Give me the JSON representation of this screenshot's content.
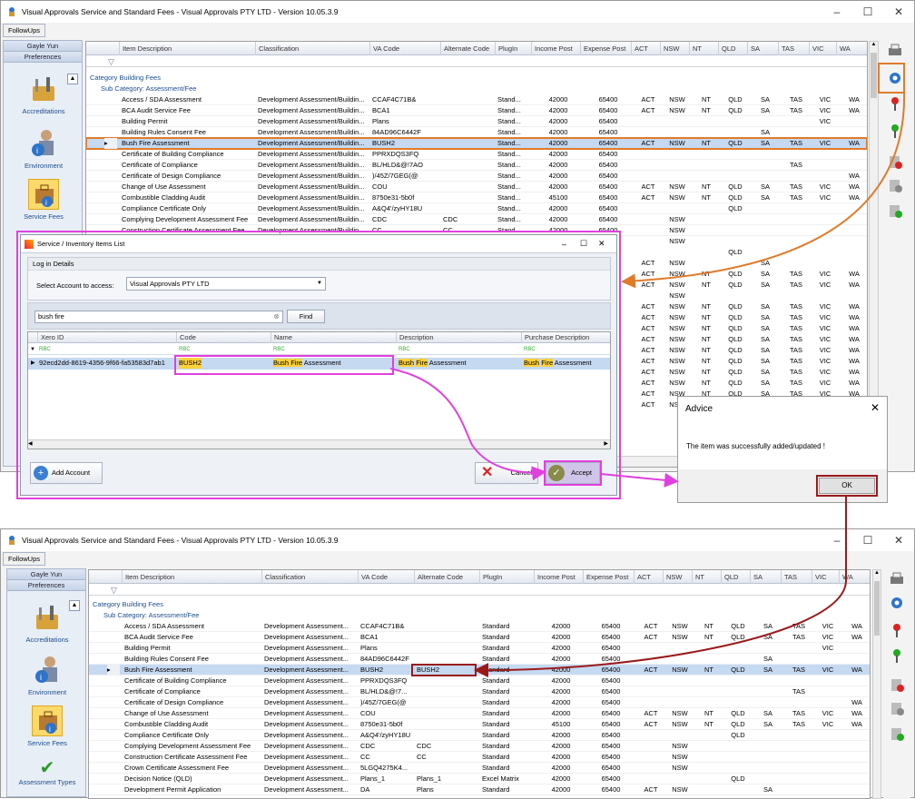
{
  "app": {
    "title": "Visual Approvals Service and Standard Fees - Visual Approvals PTY LTD - Version 10.05.3.9",
    "follow_ups": "FollowUps"
  },
  "nav": {
    "user": "Gayle Yun",
    "preferences": "Preferences",
    "items": [
      "Accreditations",
      "Environment",
      "Service Fees",
      "Assessment Types"
    ]
  },
  "grid": {
    "columns": [
      "Item Description",
      "Classification",
      "VA Code",
      "Alternate Code",
      "PlugIn",
      "Income Post",
      "Expense Post",
      "ACT",
      "NSW",
      "NT",
      "QLD",
      "SA",
      "TAS",
      "VIC",
      "WA"
    ],
    "category": "Category  Building Fees",
    "subcategory": "Sub Category:  Assessment/Fee",
    "rows_top": [
      [
        "Access / SDA Assessment",
        "Development Assessment/Buildin...",
        "CCAF4C71B&",
        "",
        "Stand...",
        "42000",
        "65400",
        "ACT",
        "NSW",
        "NT",
        "QLD",
        "SA",
        "TAS",
        "VIC",
        "WA"
      ],
      [
        "BCA Audit Service Fee",
        "Development Assessment/Buildin...",
        "BCA1",
        "",
        "Stand...",
        "42000",
        "65400",
        "ACT",
        "NSW",
        "NT",
        "QLD",
        "SA",
        "TAS",
        "VIC",
        "WA"
      ],
      [
        "Building Permit",
        "Development Assessment/Buildin...",
        "Plans",
        "",
        "Stand...",
        "42000",
        "65400",
        "",
        "",
        "",
        "",
        "",
        "",
        "VIC",
        ""
      ],
      [
        "Building Rules Consent Fee",
        "Development Assessment/Buildin...",
        "84AD96C6442F",
        "",
        "Stand...",
        "42000",
        "65400",
        "",
        "",
        "",
        "",
        "SA",
        "",
        "",
        ""
      ],
      [
        "Bush Fire Assessment",
        "Development Assessment/Buildin...",
        "BUSH2",
        "",
        "Stand...",
        "42000",
        "65400",
        "ACT",
        "NSW",
        "NT",
        "QLD",
        "SA",
        "TAS",
        "VIC",
        "WA"
      ],
      [
        "Certificate of Building Compliance",
        "Development Assessment/Buildin...",
        "PPRXDQS3FQ",
        "",
        "Stand...",
        "42000",
        "65400",
        "",
        "",
        "",
        "",
        "",
        "",
        "",
        ""
      ],
      [
        "Certificate of Compliance",
        "Development Assessment/Buildin...",
        "BL/HLD&@!7AO",
        "",
        "Stand...",
        "42000",
        "65400",
        "",
        "",
        "",
        "",
        "",
        "TAS",
        "",
        ""
      ],
      [
        "Certificate of Design Compliance",
        "Development Assessment/Buildin...",
        ")/45Z/7GEG(@",
        "",
        "Stand...",
        "42000",
        "65400",
        "",
        "",
        "",
        "",
        "",
        "",
        "",
        "WA"
      ],
      [
        "Change of Use Assessment",
        "Development Assessment/Buildin...",
        "COU",
        "",
        "Stand...",
        "42000",
        "65400",
        "ACT",
        "NSW",
        "NT",
        "QLD",
        "SA",
        "TAS",
        "VIC",
        "WA"
      ],
      [
        "Combustible Cladding Audit",
        "Development Assessment/Buildin...",
        "8750e31-5b0f",
        "",
        "Stand...",
        "45100",
        "65400",
        "ACT",
        "NSW",
        "NT",
        "QLD",
        "SA",
        "TAS",
        "VIC",
        "WA"
      ],
      [
        "Compliance Certificate Only",
        "Development Assessment/Buildin...",
        "A&Q4'/zyHY18U",
        "",
        "Stand...",
        "42000",
        "65400",
        "",
        "",
        "",
        "QLD",
        "",
        "",
        "",
        ""
      ],
      [
        "Complying Development Assessment Fee",
        "Development Assessment/Buildin...",
        "CDC",
        "CDC",
        "Stand...",
        "42000",
        "65400",
        "",
        "NSW",
        "",
        "",
        "",
        "",
        "",
        ""
      ],
      [
        "Construction Certificate Assessment Fee",
        "Development Assessment/Buildin...",
        "CC",
        "CC",
        "Stand...",
        "42000",
        "65400",
        "",
        "NSW",
        "",
        "",
        "",
        "",
        "",
        ""
      ]
    ],
    "rows_bottom": [
      [
        "Access / SDA Assessment",
        "Development Assessment...",
        "CCAF4C71B&",
        "",
        "Standard",
        "42000",
        "65400",
        "ACT",
        "NSW",
        "NT",
        "QLD",
        "SA",
        "TAS",
        "VIC",
        "WA"
      ],
      [
        "BCA Audit Service Fee",
        "Development Assessment...",
        "BCA1",
        "",
        "Standard",
        "42000",
        "65400",
        "ACT",
        "NSW",
        "NT",
        "QLD",
        "SA",
        "TAS",
        "VIC",
        "WA"
      ],
      [
        "Building Permit",
        "Development Assessment...",
        "Plans",
        "",
        "Standard",
        "42000",
        "65400",
        "",
        "",
        "",
        "",
        "",
        "",
        "VIC",
        ""
      ],
      [
        "Building Rules Consent Fee",
        "Development Assessment...",
        "84AD96C6442F",
        "",
        "Standard",
        "42000",
        "65400",
        "",
        "",
        "",
        "",
        "SA",
        "",
        "",
        ""
      ],
      [
        "Bush Fire Assessment",
        "Development Assessment...",
        "BUSH2",
        "BUSH2",
        "Standard",
        "42000",
        "65400",
        "ACT",
        "NSW",
        "NT",
        "QLD",
        "SA",
        "TAS",
        "VIC",
        "WA"
      ],
      [
        "Certificate of Building Compliance",
        "Development Assessment...",
        "PPRXDQS3FQ",
        "",
        "Standard",
        "42000",
        "65400",
        "",
        "",
        "",
        "",
        "",
        "",
        "",
        ""
      ],
      [
        "Certificate of Compliance",
        "Development Assessment...",
        "BL/HLD&@!7...",
        "",
        "Standard",
        "42000",
        "65400",
        "",
        "",
        "",
        "",
        "",
        "TAS",
        "",
        ""
      ],
      [
        "Certificate of Design Compliance",
        "Development Assessment...",
        ")/45Z/7GEG(@",
        "",
        "Standard",
        "42000",
        "65400",
        "",
        "",
        "",
        "",
        "",
        "",
        "",
        "WA"
      ],
      [
        "Change of Use Assessment",
        "Development Assessment...",
        "COU",
        "",
        "Standard",
        "42000",
        "65400",
        "ACT",
        "NSW",
        "NT",
        "QLD",
        "SA",
        "TAS",
        "VIC",
        "WA"
      ],
      [
        "Combustible Cladding Audit",
        "Development Assessment...",
        "8750e31-5b0f",
        "",
        "Standard",
        "45100",
        "65400",
        "ACT",
        "NSW",
        "NT",
        "QLD",
        "SA",
        "TAS",
        "VIC",
        "WA"
      ],
      [
        "Compliance Certificate Only",
        "Development Assessment...",
        "A&Q4'/zyHY18U",
        "",
        "Standard",
        "42000",
        "65400",
        "",
        "",
        "",
        "QLD",
        "",
        "",
        "",
        ""
      ],
      [
        "Complying Development Assessment Fee",
        "Development Assessment...",
        "CDC",
        "CDC",
        "Standard",
        "42000",
        "65400",
        "",
        "NSW",
        "",
        "",
        "",
        "",
        "",
        ""
      ],
      [
        "Construction Certificate Assessment Fee",
        "Development Assessment...",
        "CC",
        "CC",
        "Standard",
        "42000",
        "65400",
        "",
        "NSW",
        "",
        "",
        "",
        "",
        "",
        ""
      ],
      [
        "Crown Certificate Assessment Fee",
        "Development Assessment...",
        "5LGQ4275K4...",
        "",
        "Standard",
        "42000",
        "65400",
        "",
        "NSW",
        "",
        "",
        "",
        "",
        "",
        ""
      ],
      [
        "Decision Notice (QLD)",
        "Development Assessment...",
        "Plans_1",
        "Plans_1",
        "Excel Matrix",
        "42000",
        "65400",
        "",
        "",
        "",
        "QLD",
        "",
        "",
        "",
        ""
      ],
      [
        "Development Permit Application",
        "Development Assessment...",
        "DA",
        "Plans",
        "Standard",
        "42000",
        "65400",
        "ACT",
        "NSW",
        "",
        "",
        "SA",
        "",
        "",
        ""
      ]
    ],
    "peek_rows": [
      [
        "",
        "NSW",
        "",
        "",
        "",
        "",
        "",
        ""
      ],
      [
        "",
        "",
        "",
        "QLD",
        "",
        "",
        "",
        ""
      ],
      [
        "ACT",
        "NSW",
        "",
        "",
        "SA",
        "",
        "",
        ""
      ],
      [
        "ACT",
        "NSW",
        "NT",
        "QLD",
        "SA",
        "TAS",
        "VIC",
        "WA"
      ],
      [
        "ACT",
        "NSW",
        "NT",
        "QLD",
        "SA",
        "TAS",
        "VIC",
        "WA"
      ],
      [
        "",
        "NSW",
        "",
        "",
        "",
        "",
        "",
        ""
      ],
      [
        "ACT",
        "NSW",
        "NT",
        "QLD",
        "SA",
        "TAS",
        "VIC",
        "WA"
      ],
      [
        "ACT",
        "NSW",
        "NT",
        "QLD",
        "SA",
        "TAS",
        "VIC",
        "WA"
      ],
      [
        "ACT",
        "NSW",
        "NT",
        "QLD",
        "SA",
        "TAS",
        "VIC",
        "WA"
      ],
      [
        "ACT",
        "NSW",
        "NT",
        "QLD",
        "SA",
        "TAS",
        "VIC",
        "WA"
      ],
      [
        "ACT",
        "NSW",
        "NT",
        "QLD",
        "SA",
        "TAS",
        "VIC",
        "WA"
      ],
      [
        "ACT",
        "NSW",
        "NT",
        "QLD",
        "SA",
        "TAS",
        "VIC",
        "WA"
      ],
      [
        "ACT",
        "NSW",
        "NT",
        "QLD",
        "SA",
        "TAS",
        "VIC",
        "WA"
      ],
      [
        "ACT",
        "NSW",
        "NT",
        "QLD",
        "SA",
        "TAS",
        "VIC",
        "WA"
      ],
      [
        "ACT",
        "NSW",
        "NT",
        "QLD",
        "SA",
        "TAS",
        "VIC",
        "WA"
      ],
      [
        "ACT",
        "NSW",
        "NT",
        "QLD",
        "SA",
        "TAS",
        "VIC",
        "WA"
      ]
    ]
  },
  "dialog": {
    "title": "Service / Inventory Items List",
    "group": "Log in Details",
    "account_label": "Select Account to access:",
    "account_value": "Visual Approvals PTY LTD",
    "search_value": "bush fire",
    "find": "Find",
    "columns": [
      "Xero ID",
      "Code",
      "Name",
      "Description",
      "Purchase Description"
    ],
    "row": {
      "xero_id": "92ecd2dd-8619-4356-9f66-fa53583d7ab1",
      "code": "BUSH2",
      "name_a": "Bush ",
      "name_hl": "Fire",
      "name_b": " Assessment",
      "desc_hl_a": "Bush",
      "desc_hl_b": "Fire",
      "desc_b": " Assessment",
      "pdesc_hl_a": "Bush",
      "pdesc_hl_b": "Fire",
      "pdesc_b": " Assessment"
    },
    "add_account": "Add Account",
    "cancel": "Cancel",
    "accept": "Accept"
  },
  "advice": {
    "title": "Advice",
    "message": "The item was successfully added/updated !",
    "ok": "OK"
  },
  "colors": {
    "orange": "#e07b2a",
    "magenta": "#e040e0",
    "darkred": "#9a1a1a",
    "selection": "#c5d9f1"
  }
}
